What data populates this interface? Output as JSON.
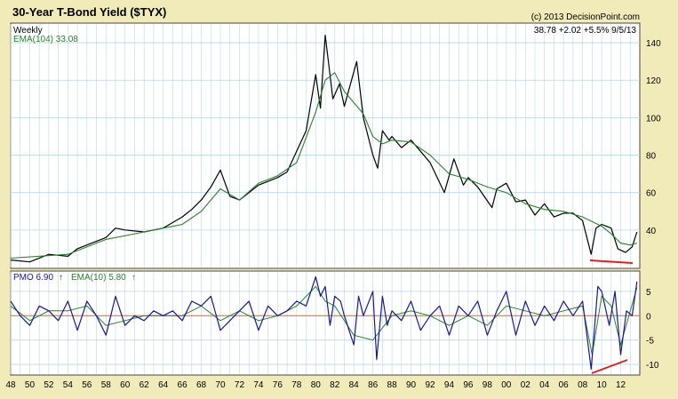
{
  "header": {
    "title": "30-Year T-Bond Yield ($TYX)",
    "copyright": "(c) 2013 DecisionPoint.com",
    "weekly": "Weekly",
    "ema_label": "EMA(104) 33.08",
    "quote": "38.78 +2.02 +5.5% 9/5/13"
  },
  "pmo_legend": {
    "pmo_text": "PMO 6.90",
    "ema_text": "EMA(10) 5.80"
  },
  "colors": {
    "background": "#f0ebb8",
    "panel": "#ffffff",
    "grid": "#b8d8ec",
    "price": "#000000",
    "ema": "#2e7d2e",
    "pmo": "#1a1a8c",
    "zero_line": "#e07020",
    "divergence": "#e02020"
  },
  "chart_data": [
    {
      "type": "line",
      "title": "30-Year T-Bond Yield ($TYX)",
      "subtitle": "Weekly",
      "ylim": [
        20,
        150
      ],
      "xlim": [
        1948,
        2014
      ],
      "yticks": [
        40,
        60,
        80,
        100,
        120,
        140
      ],
      "grid": true,
      "series": [
        {
          "name": "$TYX",
          "x": [
            1948,
            1950,
            1952,
            1954,
            1955,
            1956,
            1958,
            1959,
            1960,
            1962,
            1964,
            1966,
            1967,
            1968,
            1969,
            1970,
            1971,
            1972,
            1974,
            1976,
            1977,
            1978,
            1979,
            1980,
            1980.5,
            1981,
            1981.8,
            1982.5,
            1983,
            1984.3,
            1985,
            1986,
            1986.5,
            1987,
            1987.7,
            1988,
            1989,
            1990,
            1991,
            1992,
            1993.5,
            1994.5,
            1995.5,
            1996,
            1997,
            1998.5,
            1999,
            2000,
            2001,
            2002,
            2003,
            2004,
            2005,
            2006,
            2007,
            2008,
            2008.9,
            2009.4,
            2010,
            2011,
            2011.7,
            2012.5,
            2013.2,
            2013.7
          ],
          "y": [
            24,
            23,
            27,
            26,
            30,
            32,
            36,
            41,
            40,
            39,
            41,
            47,
            51,
            56,
            63,
            72,
            58,
            56,
            64,
            68,
            71,
            82,
            93,
            123,
            105,
            144,
            110,
            118,
            106,
            130,
            100,
            80,
            73,
            93,
            88,
            90,
            84,
            88,
            82,
            76,
            60,
            78,
            64,
            68,
            63,
            52,
            62,
            65,
            55,
            56,
            48,
            54,
            47,
            49,
            49,
            45,
            27,
            41,
            43,
            41,
            30,
            28,
            31,
            39
          ]
        },
        {
          "name": "EMA(104)",
          "x": [
            1948,
            1954,
            1958,
            1962,
            1966,
            1968,
            1970,
            1972,
            1974,
            1976,
            1978,
            1980,
            1981,
            1982,
            1983,
            1984,
            1985,
            1986,
            1987,
            1988,
            1990,
            1992,
            1994,
            1996,
            1998,
            2000,
            2002,
            2004,
            2006,
            2008,
            2010,
            2011,
            2012,
            2013,
            2013.7
          ],
          "y": [
            25,
            27,
            35,
            39,
            43,
            50,
            62,
            56,
            65,
            69,
            76,
            103,
            120,
            124,
            114,
            108,
            102,
            90,
            86,
            88,
            87,
            80,
            70,
            67,
            63,
            60,
            54,
            51,
            50,
            47,
            42,
            38,
            33,
            32,
            33
          ]
        }
      ]
    },
    {
      "type": "line",
      "title": "PMO",
      "ylim": [
        -12,
        9
      ],
      "yticks": [
        -10,
        -5,
        0,
        5
      ],
      "grid": true,
      "series": [
        {
          "name": "PMO",
          "x": [
            1948,
            1949,
            1950,
            1951,
            1952,
            1953,
            1954,
            1955,
            1956,
            1957,
            1958,
            1959,
            1960,
            1961,
            1962,
            1963,
            1964,
            1965,
            1966,
            1967,
            1968,
            1969,
            1970,
            1971,
            1972,
            1973,
            1974,
            1975,
            1976,
            1977,
            1978,
            1979,
            1980,
            1980.5,
            1981,
            1981.5,
            1982,
            1982.6,
            1983,
            1984,
            1984.5,
            1985,
            1986,
            1986.4,
            1987,
            1987.5,
            1988,
            1989,
            1990,
            1991,
            1992,
            1993,
            1994,
            1995,
            1996,
            1997,
            1998,
            1999,
            2000,
            2001,
            2002,
            2003,
            2004,
            2005,
            2006,
            2007,
            2008,
            2008.9,
            2009.6,
            2010,
            2010.8,
            2011.4,
            2012,
            2012.6,
            2013.2,
            2013.7
          ],
          "y": [
            3,
            0,
            -2,
            2,
            1,
            -1,
            3,
            -3,
            3,
            0,
            -4,
            4,
            -2,
            0,
            -1,
            1,
            0,
            1,
            -1,
            3,
            2,
            4,
            -3,
            -1,
            1,
            3,
            -3,
            2,
            0,
            1,
            3,
            2,
            8,
            4,
            6,
            -2,
            4,
            3,
            0,
            -6,
            4,
            0,
            5,
            -9,
            4,
            -2,
            1,
            -1,
            3,
            -3,
            0,
            2,
            -4,
            2,
            0,
            3,
            -4,
            1,
            5,
            -4,
            3,
            -2,
            2,
            -1,
            3,
            0,
            3,
            -11,
            6,
            5,
            -2,
            5,
            -8,
            1,
            0,
            7
          ]
        },
        {
          "name": "EMA(10)",
          "x": [
            1948,
            1950,
            1952,
            1954,
            1956,
            1958,
            1960,
            1962,
            1964,
            1966,
            1968,
            1970,
            1972,
            1974,
            1976,
            1978,
            1980,
            1981,
            1982,
            1984,
            1986,
            1988,
            1990,
            1992,
            1994,
            1996,
            1998,
            2000,
            2002,
            2004,
            2006,
            2008,
            2009,
            2010,
            2011,
            2012,
            2013,
            2013.7
          ],
          "y": [
            2,
            -1,
            1,
            1,
            2,
            -2,
            -1,
            0,
            0,
            0,
            2,
            -1,
            1,
            -1,
            0,
            2,
            6,
            3,
            2,
            -4,
            -5,
            0,
            1,
            0,
            -2,
            0,
            -2,
            2,
            1,
            0,
            1,
            2,
            -8,
            4,
            2,
            -6,
            1,
            5.8
          ]
        }
      ]
    }
  ],
  "x_axis": {
    "tick_labels": [
      "48",
      "50",
      "52",
      "54",
      "56",
      "58",
      "60",
      "62",
      "64",
      "66",
      "68",
      "70",
      "72",
      "74",
      "76",
      "78",
      "80",
      "82",
      "84",
      "86",
      "88",
      "90",
      "92",
      "94",
      "96",
      "98",
      "00",
      "02",
      "04",
      "06",
      "08",
      "10",
      "12"
    ]
  }
}
